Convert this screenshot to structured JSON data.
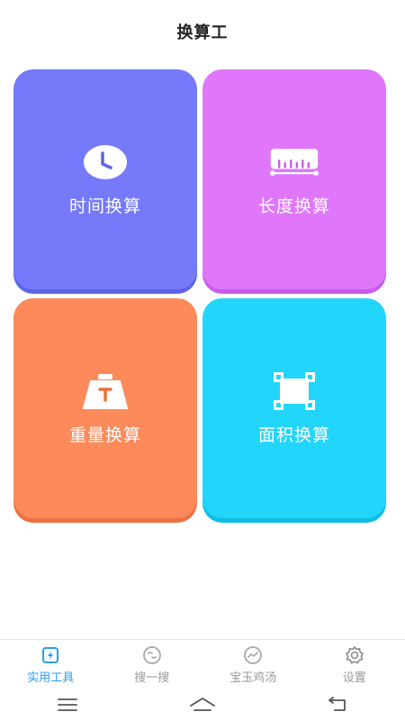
{
  "header": {
    "title": "换算工"
  },
  "tiles": [
    {
      "label": "时间换算",
      "icon": "clock-icon",
      "color": "#7579fa"
    },
    {
      "label": "长度换算",
      "icon": "ruler-icon",
      "color": "#e077fb"
    },
    {
      "label": "重量换算",
      "icon": "weight-icon",
      "color": "#fc8a5b"
    },
    {
      "label": "面积换算",
      "icon": "area-icon",
      "color": "#22d5fb"
    }
  ],
  "tabbar": {
    "active_color": "#2e9bf0",
    "inactive_color": "#9a9a9a",
    "items": [
      {
        "label": "实用工具",
        "icon": "tools-icon",
        "active": true
      },
      {
        "label": "搜一搜",
        "icon": "search-face-icon",
        "active": false
      },
      {
        "label": "宝玉鸡汤",
        "icon": "trend-icon",
        "active": false
      },
      {
        "label": "设置",
        "icon": "gear-icon",
        "active": false
      }
    ]
  },
  "system_nav": {
    "items": [
      {
        "icon": "menu-icon"
      },
      {
        "icon": "home-icon"
      },
      {
        "icon": "back-icon"
      }
    ]
  }
}
